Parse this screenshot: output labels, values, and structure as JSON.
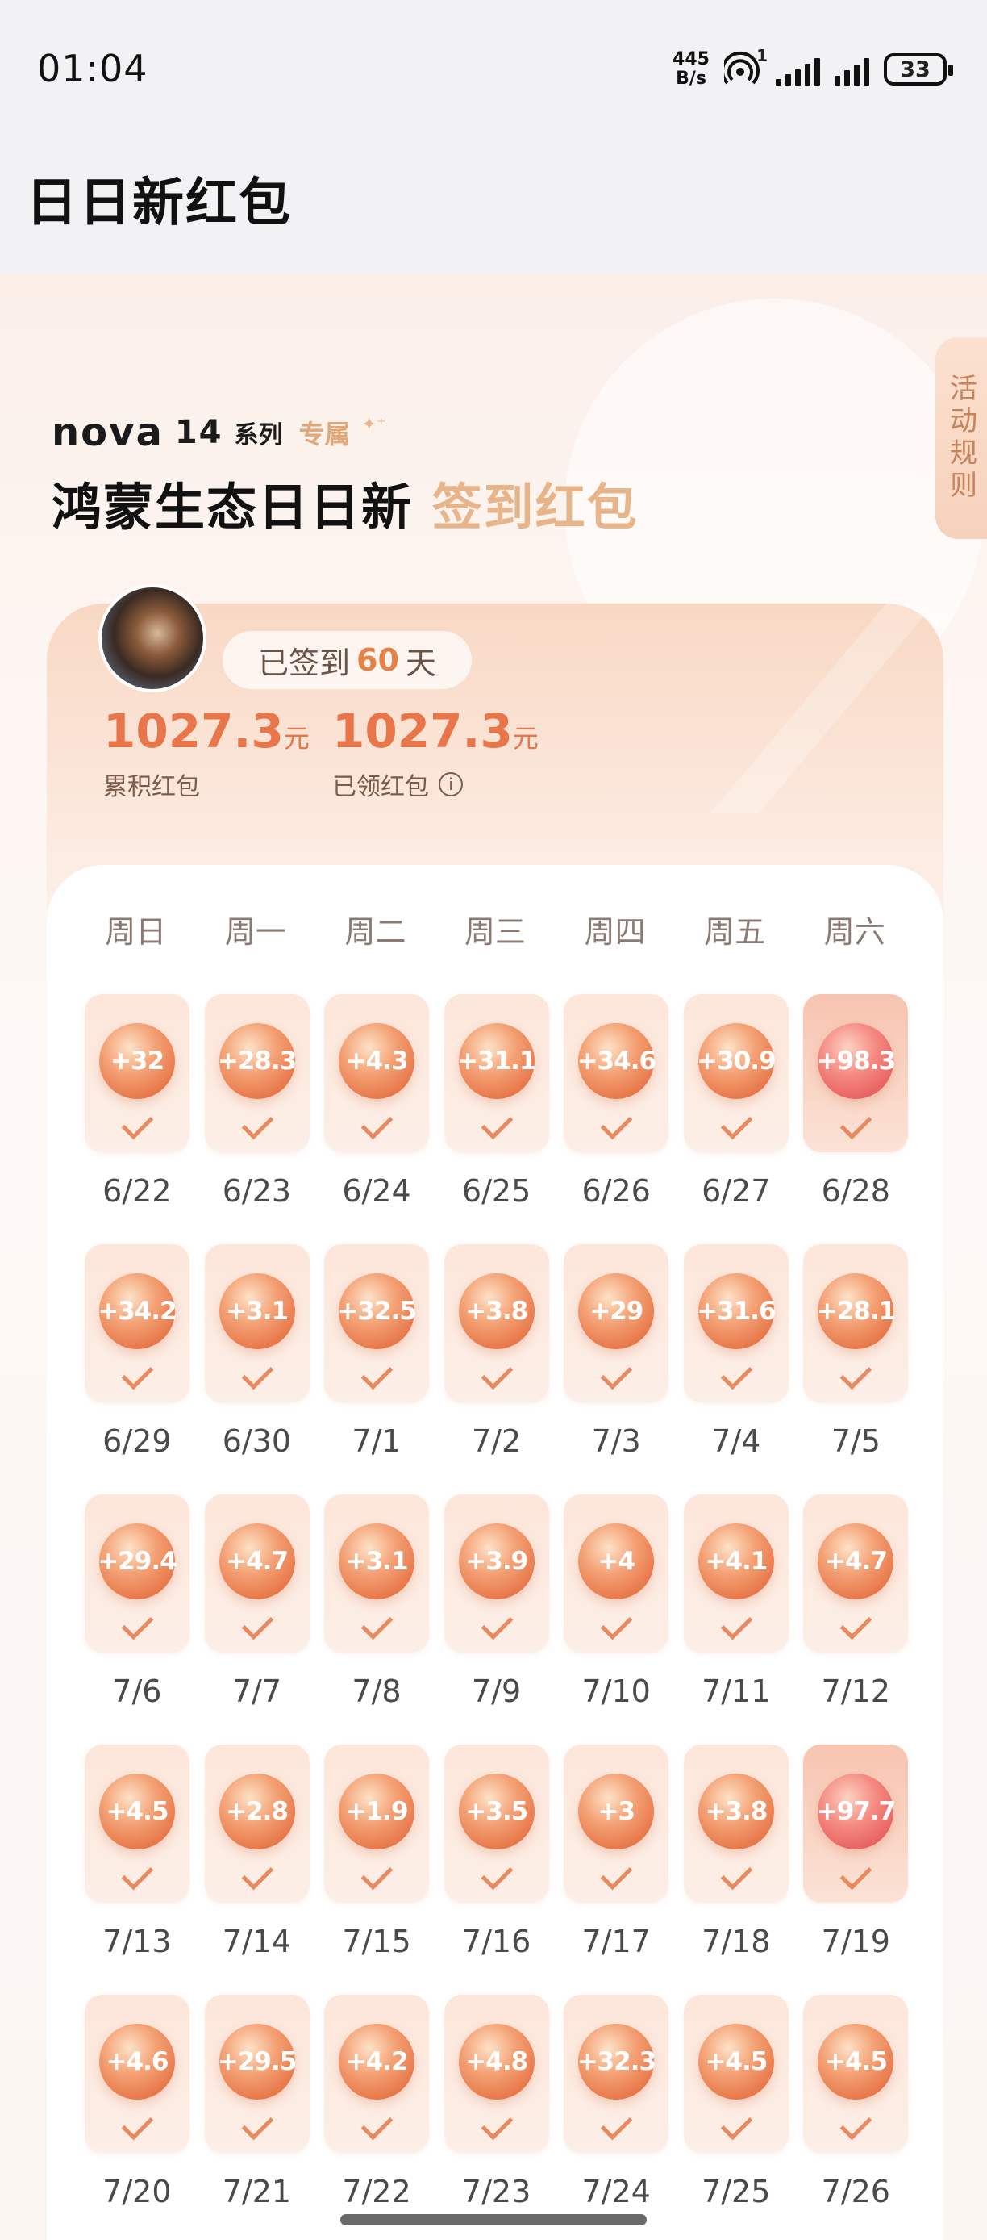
{
  "status_bar": {
    "time": "01:04",
    "net_speed_value": "445",
    "net_speed_unit": "B/s",
    "hotspot_badge": "1",
    "battery": "33"
  },
  "page": {
    "title": "日日新红包"
  },
  "hero": {
    "brand": "nova",
    "model": "14",
    "series": "系列",
    "exclusive": "专属",
    "headline_main": "鸿蒙生态日日新",
    "headline_accent": "签到红包",
    "rules_tab": "活动规则"
  },
  "summary": {
    "signed_prefix": "已签到",
    "signed_days": "60",
    "signed_suffix": "天",
    "accumulated_value": "1027.3",
    "accumulated_unit": "元",
    "accumulated_label": "累积红包",
    "claimed_value": "1027.3",
    "claimed_unit": "元",
    "claimed_label": "已领红包"
  },
  "calendar": {
    "weekdays": [
      "周日",
      "周一",
      "周二",
      "周三",
      "周四",
      "周五",
      "周六"
    ],
    "weeks": [
      [
        {
          "amount": "+32",
          "date": "6/22"
        },
        {
          "amount": "+28.3",
          "date": "6/23"
        },
        {
          "amount": "+4.3",
          "date": "6/24"
        },
        {
          "amount": "+31.1",
          "date": "6/25"
        },
        {
          "amount": "+34.6",
          "date": "6/26"
        },
        {
          "amount": "+30.9",
          "date": "6/27"
        },
        {
          "amount": "+98.3",
          "date": "6/28",
          "big": true
        }
      ],
      [
        {
          "amount": "+34.2",
          "date": "6/29"
        },
        {
          "amount": "+3.1",
          "date": "6/30"
        },
        {
          "amount": "+32.5",
          "date": "7/1"
        },
        {
          "amount": "+3.8",
          "date": "7/2"
        },
        {
          "amount": "+29",
          "date": "7/3"
        },
        {
          "amount": "+31.6",
          "date": "7/4"
        },
        {
          "amount": "+28.1",
          "date": "7/5"
        }
      ],
      [
        {
          "amount": "+29.4",
          "date": "7/6"
        },
        {
          "amount": "+4.7",
          "date": "7/7"
        },
        {
          "amount": "+3.1",
          "date": "7/8"
        },
        {
          "amount": "+3.9",
          "date": "7/9"
        },
        {
          "amount": "+4",
          "date": "7/10"
        },
        {
          "amount": "+4.1",
          "date": "7/11"
        },
        {
          "amount": "+4.7",
          "date": "7/12"
        }
      ],
      [
        {
          "amount": "+4.5",
          "date": "7/13"
        },
        {
          "amount": "+2.8",
          "date": "7/14"
        },
        {
          "amount": "+1.9",
          "date": "7/15"
        },
        {
          "amount": "+3.5",
          "date": "7/16"
        },
        {
          "amount": "+3",
          "date": "7/17"
        },
        {
          "amount": "+3.8",
          "date": "7/18"
        },
        {
          "amount": "+97.7",
          "date": "7/19",
          "big": true
        }
      ],
      [
        {
          "amount": "+4.6",
          "date": "7/20"
        },
        {
          "amount": "+29.5",
          "date": "7/21"
        },
        {
          "amount": "+4.2",
          "date": "7/22"
        },
        {
          "amount": "+4.8",
          "date": "7/23"
        },
        {
          "amount": "+32.3",
          "date": "7/24"
        },
        {
          "amount": "+4.5",
          "date": "7/25"
        },
        {
          "amount": "+4.5",
          "date": "7/26"
        }
      ]
    ]
  }
}
